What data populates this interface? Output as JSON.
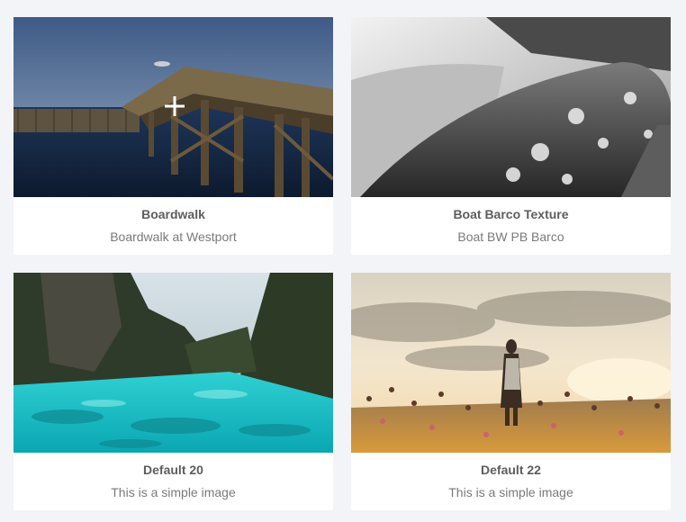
{
  "gallery": {
    "items": [
      {
        "title": "Boardwalk",
        "subtitle": "Boardwalk at Westport",
        "image": "boardwalk-photo"
      },
      {
        "title": "Boat Barco Texture",
        "subtitle": "Boat BW PB Barco",
        "image": "boat-texture-photo"
      },
      {
        "title": "Default 20",
        "subtitle": "This is a simple image",
        "image": "lagoon-photo"
      },
      {
        "title": "Default 22",
        "subtitle": "This is a simple image",
        "image": "meadow-sunset-photo"
      }
    ]
  },
  "colors": {
    "page_background": "#f3f4f8",
    "card_background": "#ffffff",
    "title_text": "#5d5d5d",
    "subtitle_text": "#7a7a7a"
  },
  "cursor": {
    "icon": "crosshair-cursor-icon"
  }
}
